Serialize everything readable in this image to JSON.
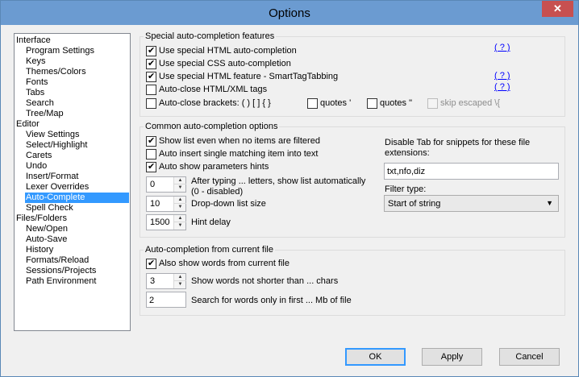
{
  "window": {
    "title": "Options",
    "close_glyph": "✕"
  },
  "tree": [
    {
      "label": "Interface",
      "level": 0
    },
    {
      "label": "Program Settings",
      "level": 1
    },
    {
      "label": "Keys",
      "level": 1
    },
    {
      "label": "Themes/Colors",
      "level": 1
    },
    {
      "label": "Fonts",
      "level": 1
    },
    {
      "label": "Tabs",
      "level": 1
    },
    {
      "label": "Search",
      "level": 1
    },
    {
      "label": "Tree/Map",
      "level": 1
    },
    {
      "label": "Editor",
      "level": 0
    },
    {
      "label": "View Settings",
      "level": 1
    },
    {
      "label": "Select/Highlight",
      "level": 1
    },
    {
      "label": "Carets",
      "level": 1
    },
    {
      "label": "Undo",
      "level": 1
    },
    {
      "label": "Insert/Format",
      "level": 1
    },
    {
      "label": "Lexer Overrides",
      "level": 1
    },
    {
      "label": "Auto-Complete",
      "level": 1,
      "selected": true
    },
    {
      "label": "Spell Check",
      "level": 1
    },
    {
      "label": "Files/Folders",
      "level": 0
    },
    {
      "label": "New/Open",
      "level": 1
    },
    {
      "label": "Auto-Save",
      "level": 1
    },
    {
      "label": "History",
      "level": 1
    },
    {
      "label": "Formats/Reload",
      "level": 1
    },
    {
      "label": "Sessions/Projects",
      "level": 1
    },
    {
      "label": "Path Environment",
      "level": 1
    }
  ],
  "special": {
    "title": "Special auto-completion features",
    "html_auto": {
      "label": "Use special HTML auto-completion",
      "checked": true
    },
    "css_auto": {
      "label": "Use special CSS auto-completion",
      "checked": true
    },
    "smarttag": {
      "label": "Use special HTML feature - SmartTagTabbing",
      "checked": true
    },
    "autoclose_tags": {
      "label": "Auto-close HTML/XML tags",
      "checked": false
    },
    "autoclose_brackets": {
      "label": "Auto-close brackets: ( ) [ ] { }",
      "checked": false
    },
    "quotes_single": {
      "label": "quotes '",
      "checked": false
    },
    "quotes_double": {
      "label": "quotes \"",
      "checked": false
    },
    "skip_escaped": {
      "label": "skip escaped \\{",
      "checked": false,
      "disabled": true
    },
    "help": "( ? )"
  },
  "common": {
    "title": "Common auto-completion options",
    "show_list": {
      "label": "Show list even when no items are filtered",
      "checked": true
    },
    "auto_insert": {
      "label": "Auto insert single matching item into text",
      "checked": false
    },
    "param_hints": {
      "label": "Auto show parameters hints",
      "checked": true
    },
    "after_typing": {
      "value": "0",
      "label1": "After typing ... letters, show list automatically",
      "label2": "(0 - disabled)"
    },
    "dropdown_size": {
      "value": "10",
      "label": "Drop-down list size"
    },
    "hint_delay": {
      "value": "1500",
      "label": "Hint delay"
    },
    "disable_tab_label": "Disable Tab for snippets for these file extensions:",
    "extensions": "txt,nfo,diz",
    "filter_label": "Filter type:",
    "filter_value": "Start of string"
  },
  "current_file": {
    "title": "Auto-completion from current file",
    "also_show": {
      "label": "Also show words from current file",
      "checked": true
    },
    "min_len": {
      "value": "3",
      "label": "Show words not shorter than ... chars"
    },
    "first_mb": {
      "value": "2",
      "label": "Search for words only in first ... Mb of file"
    }
  },
  "buttons": {
    "ok": "OK",
    "apply": "Apply",
    "cancel": "Cancel"
  }
}
